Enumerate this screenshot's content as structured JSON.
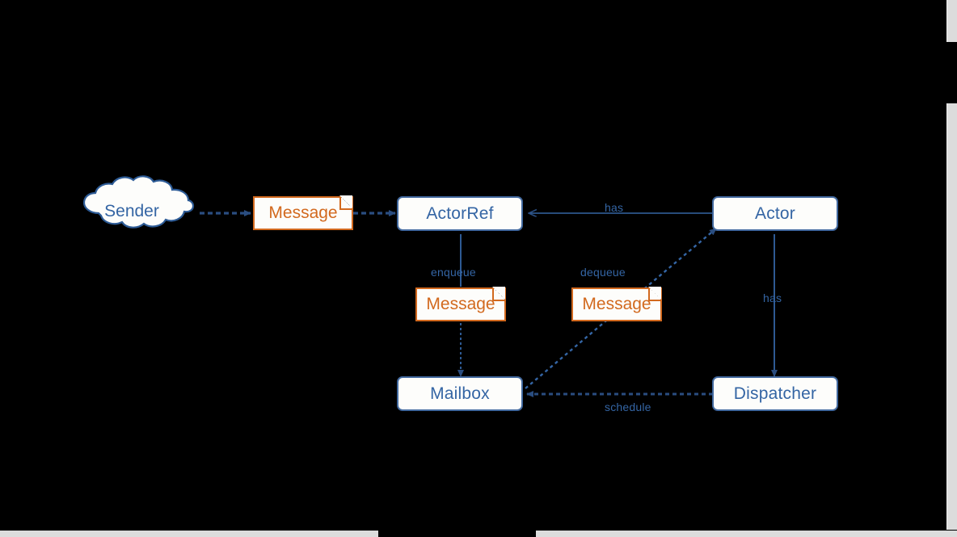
{
  "diagram": {
    "type": "actor-model-message-flow",
    "background_color": "#000000",
    "node_fill": "#fdfdfb",
    "node_border_color": "#41689e",
    "node_text_color": "#3465a4",
    "note_border_color": "#d2691e",
    "note_text_color": "#d2691e",
    "edge_color": "#3465a4",
    "nodes": [
      {
        "id": "sender",
        "label": "Sender",
        "shape": "cloud"
      },
      {
        "id": "actorref",
        "label": "ActorRef",
        "shape": "rounded-rect"
      },
      {
        "id": "actor",
        "label": "Actor",
        "shape": "rounded-rect"
      },
      {
        "id": "mailbox",
        "label": "Mailbox",
        "shape": "rounded-rect"
      },
      {
        "id": "dispatcher",
        "label": "Dispatcher",
        "shape": "rounded-rect"
      }
    ],
    "notes": [
      {
        "id": "msg-send",
        "label": "Message"
      },
      {
        "id": "msg-enqueue",
        "label": "Message"
      },
      {
        "id": "msg-dequeue",
        "label": "Message"
      }
    ],
    "edges": [
      {
        "id": "sender-to-msg",
        "from": "sender",
        "to": "msg-send",
        "label": "",
        "style": "dotted"
      },
      {
        "id": "msg-to-actorref",
        "from": "msg-send",
        "to": "actorref",
        "label": "",
        "style": "dotted"
      },
      {
        "id": "actor-has-actorref",
        "from": "actor",
        "to": "actorref",
        "label": "has",
        "style": "solid"
      },
      {
        "id": "actorref-enqueue",
        "from": "actorref",
        "to": "mailbox",
        "label": "enqueue",
        "style": "solid-dotted"
      },
      {
        "id": "mailbox-dequeue",
        "from": "mailbox",
        "to": "actor",
        "label": "dequeue",
        "style": "dotted"
      },
      {
        "id": "actor-has-dispatcher",
        "from": "actor",
        "to": "dispatcher",
        "label": "has",
        "style": "solid"
      },
      {
        "id": "dispatcher-schedule",
        "from": "dispatcher",
        "to": "mailbox",
        "label": "schedule",
        "style": "dotted"
      }
    ]
  },
  "scrollbars": {
    "vertical_present": true,
    "horizontal_present": true
  }
}
